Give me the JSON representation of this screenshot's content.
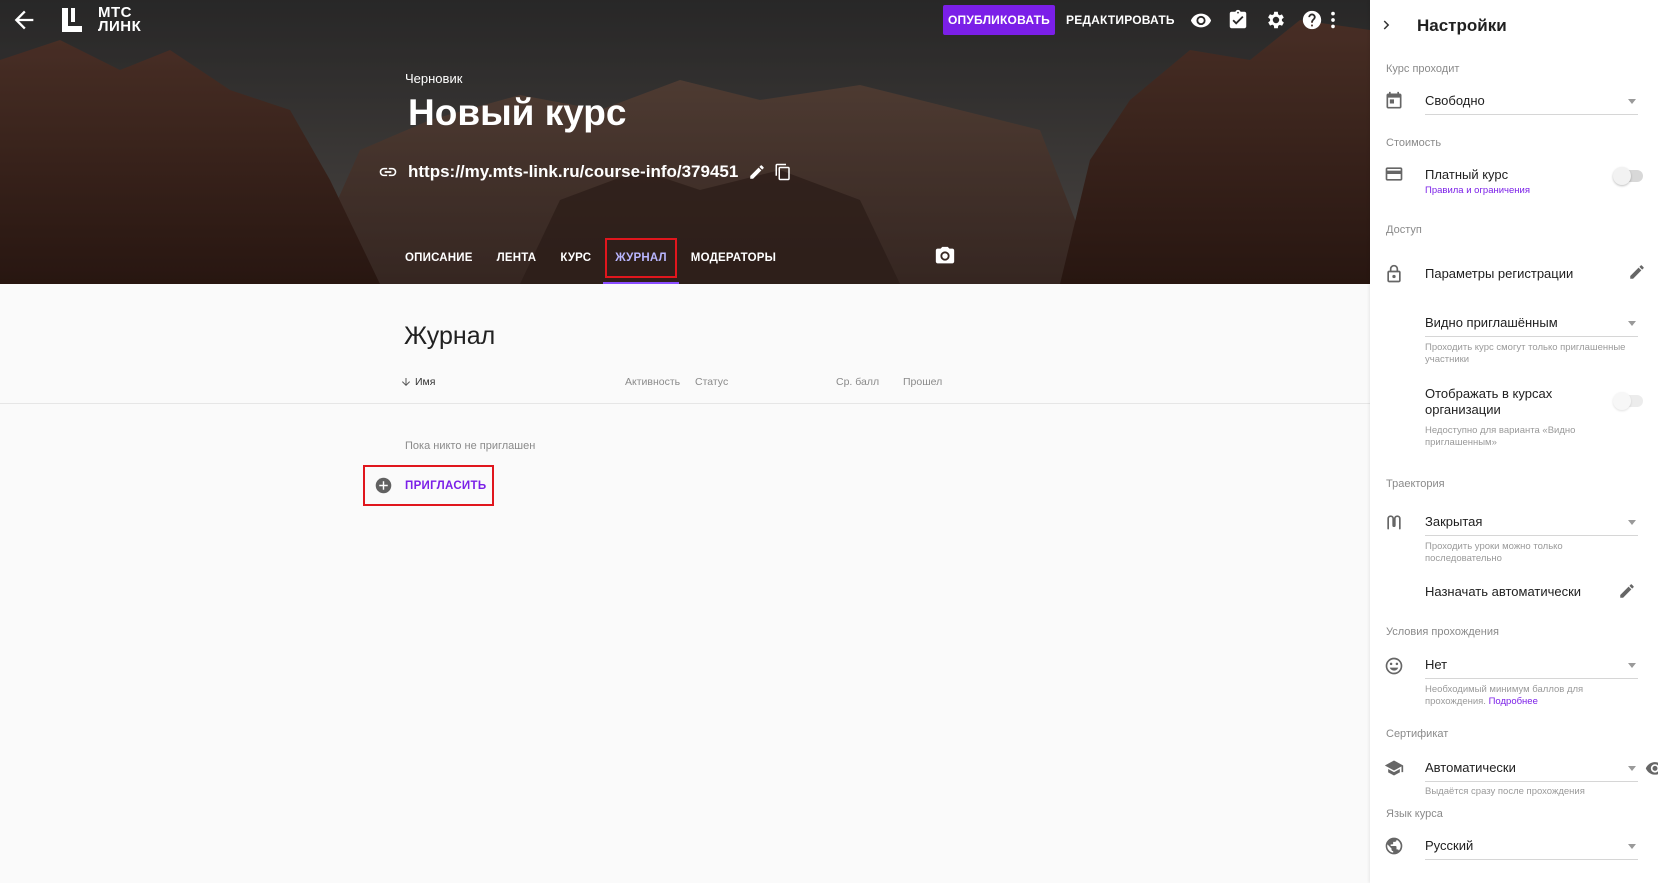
{
  "colors": {
    "accent": "#7b1fe8",
    "highlight": "#e0161d"
  },
  "header": {
    "logo_line1": "МТС",
    "logo_line2": "ЛИНК",
    "publish_label": "ОПУБЛИКОВАТЬ",
    "edit_label": "РЕДАКТИРОВАТЬ",
    "icons": [
      "arrow-back-icon",
      "eye-icon",
      "clipboard-check-icon",
      "gear-icon",
      "help-icon",
      "more-vert-icon"
    ]
  },
  "course": {
    "status": "Черновик",
    "title": "Новый курс",
    "url": "https://my.mts-link.ru/course-info/379451"
  },
  "tabs": [
    {
      "label": "ОПИСАНИЕ"
    },
    {
      "label": "ЛЕНТА"
    },
    {
      "label": "КУРС"
    },
    {
      "label": "ЖУРНАЛ",
      "active": true
    },
    {
      "label": "МОДЕРАТОРЫ"
    }
  ],
  "journal": {
    "title": "Журнал",
    "columns": [
      "Имя",
      "Активность",
      "Статус",
      "Ср. балл",
      "Прошел"
    ],
    "empty_message": "Пока никто не приглашен",
    "invite_label": "ПРИГЛАСИТЬ"
  },
  "settings": {
    "title": "Настройки",
    "course_runs": {
      "label": "Курс проходит",
      "value": "Свободно"
    },
    "cost": {
      "label": "Стоимость",
      "paid_label": "Платный курс",
      "rules_link": "Правила и ограничения",
      "paid_enabled": false
    },
    "access": {
      "label": "Доступ",
      "registration_label": "Параметры регистрации",
      "visibility_value": "Видно приглашённым",
      "visibility_hint": "Проходить курс смогут только приглашенные участники",
      "show_in_org_label": "Отображать в курсах организации",
      "show_in_org_hint": "Недоступно для варианта «Видно приглашенным»",
      "show_in_org_enabled": false
    },
    "trajectory": {
      "label": "Траектория",
      "value": "Закрытая",
      "hint": "Проходить уроки можно только последовательно",
      "assign_label": "Назначать автоматически"
    },
    "conditions": {
      "label": "Условия прохождения",
      "value": "Нет",
      "hint": "Необходимый минимум баллов для прохождения.",
      "hint_link": "Подробнее"
    },
    "certificate": {
      "label": "Сертификат",
      "value": "Автоматически",
      "hint": "Выдаётся сразу после прохождения"
    },
    "language": {
      "label": "Язык курса",
      "value": "Русский"
    }
  }
}
